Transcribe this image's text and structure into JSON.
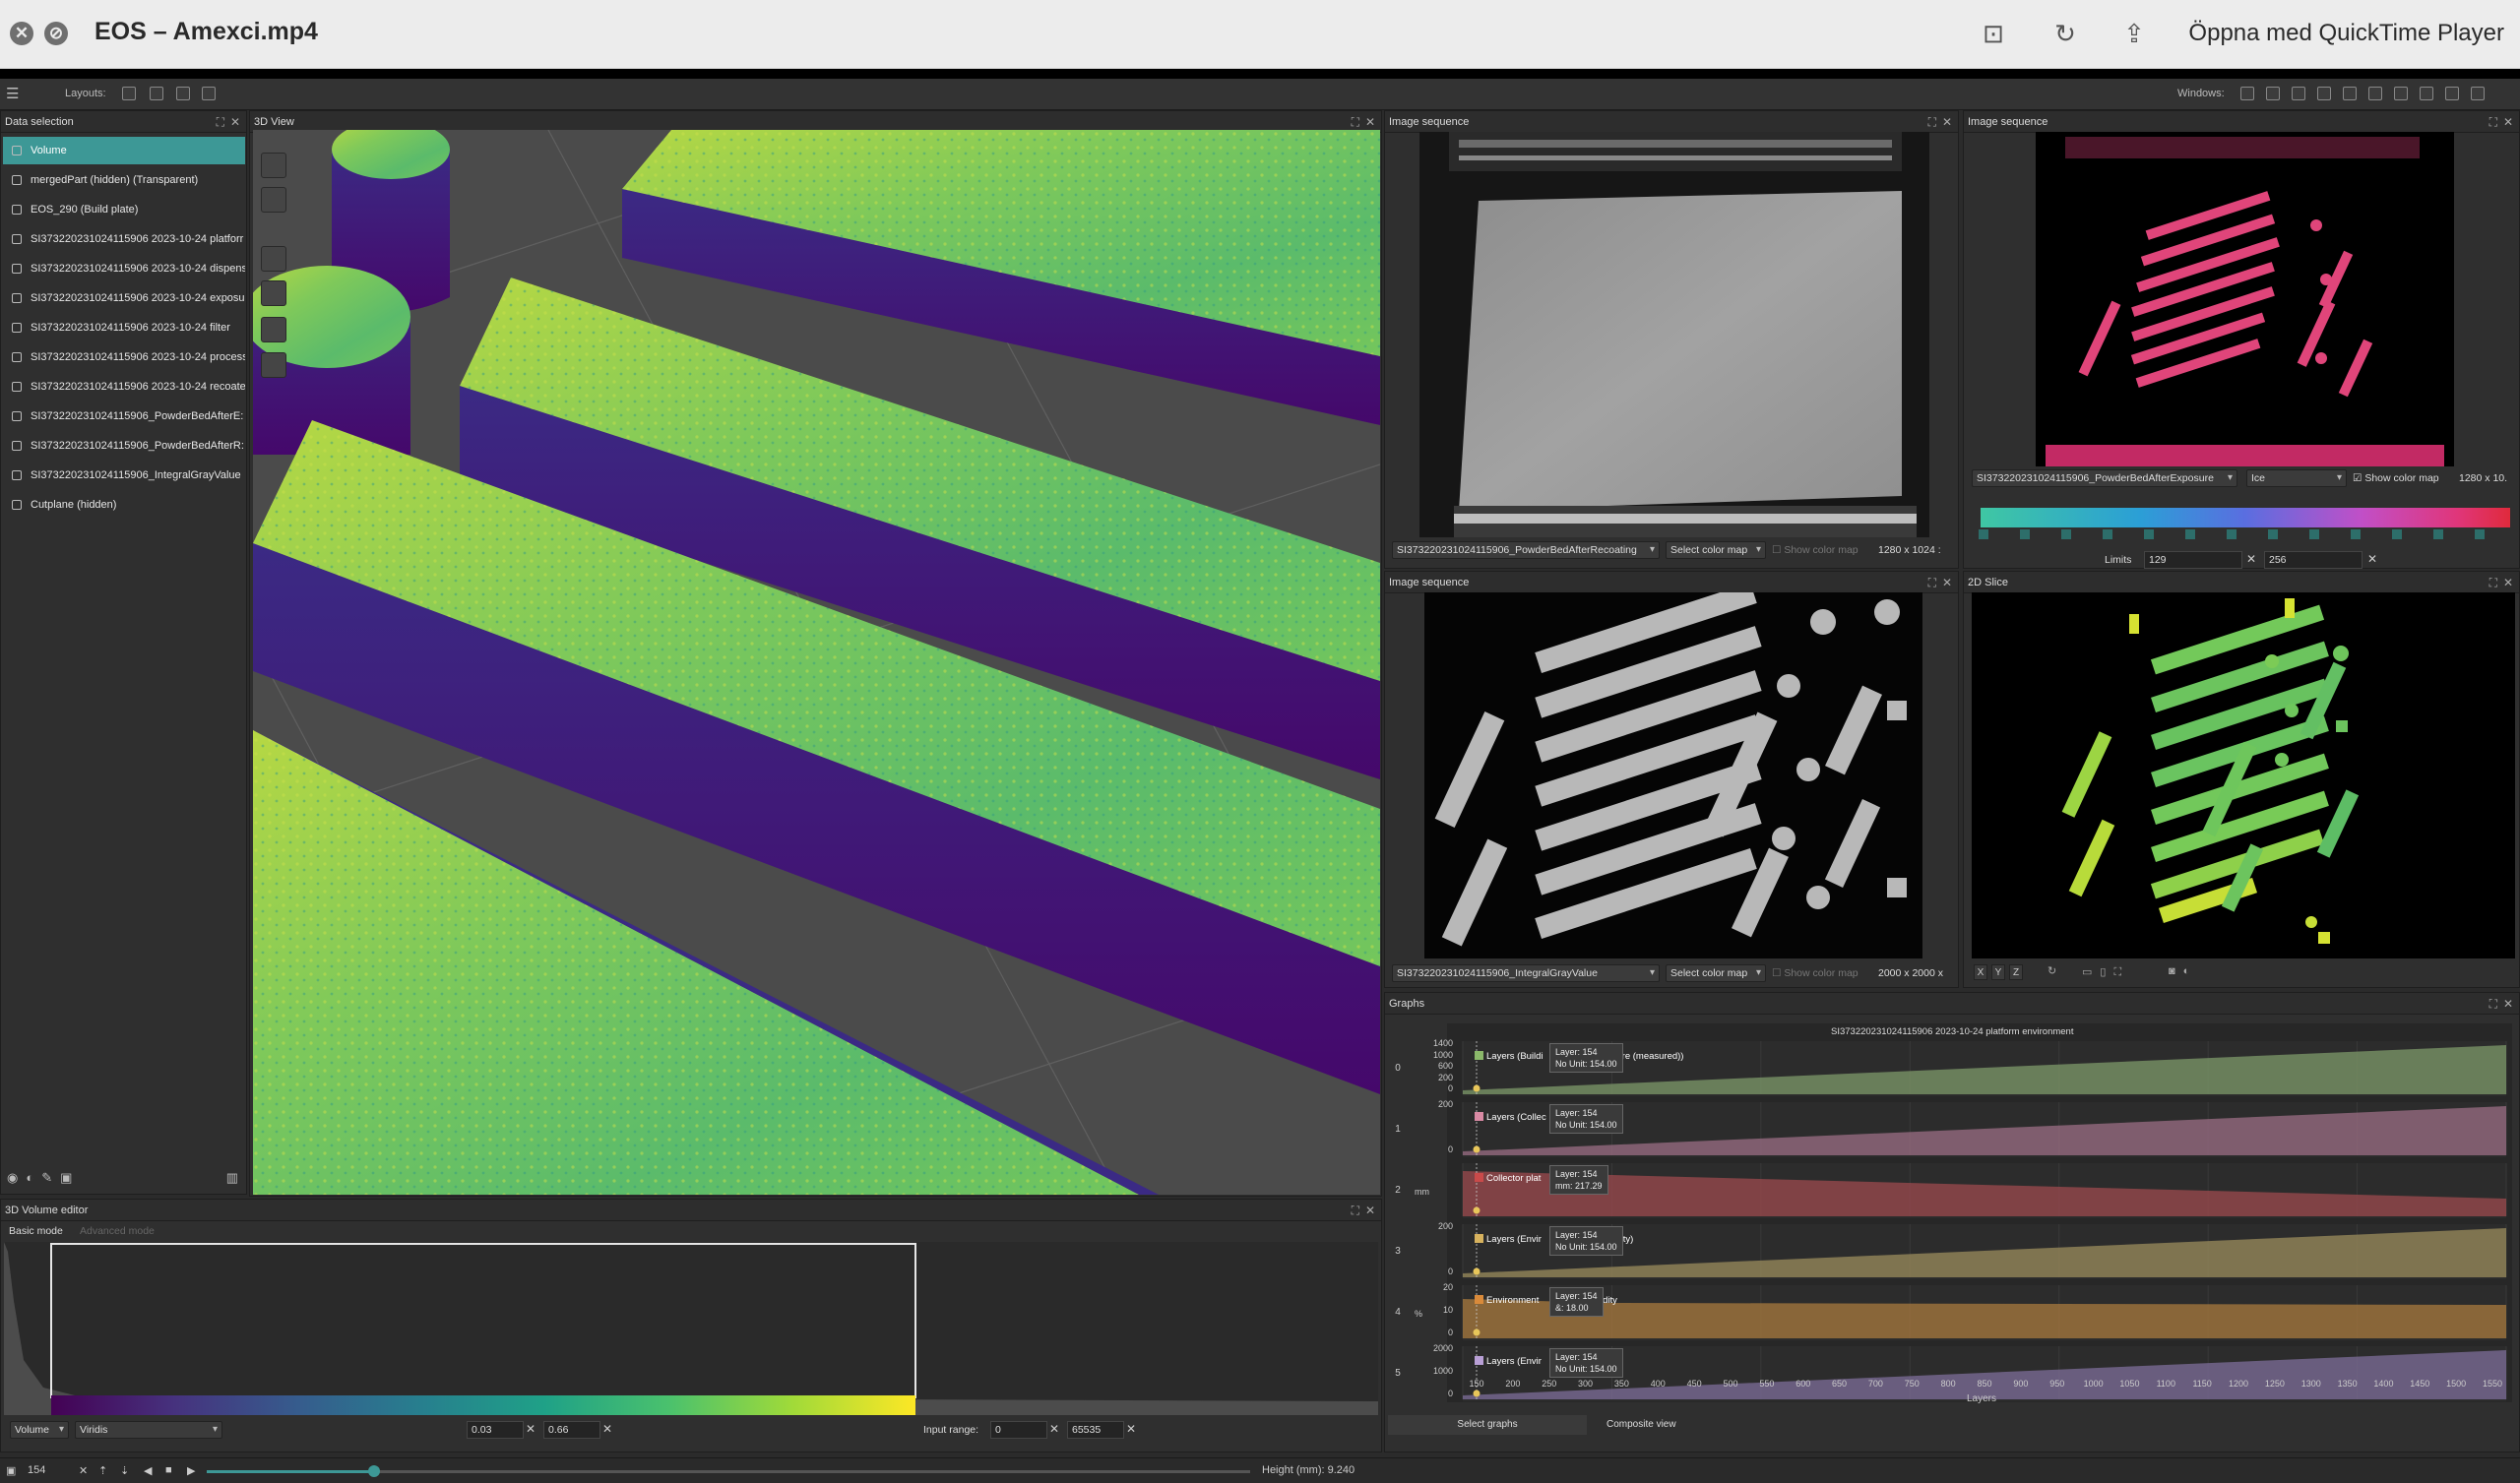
{
  "window": {
    "title": "EOS – Amexci.mp4",
    "open_with_label": "Öppna med QuickTime Player",
    "close_glyph": "✕",
    "stop_glyph": "⊘",
    "trim_glyph": "⊡",
    "rotate_glyph": "↻",
    "share_glyph": "⇪"
  },
  "appbar": {
    "menu_glyph": "☰",
    "layouts_label": "Layouts:",
    "windows_label": "Windows:"
  },
  "data_selection": {
    "title": "Data selection",
    "items": [
      {
        "label": "Volume",
        "selected": true,
        "icon": "target-icon"
      },
      {
        "label": "mergedPart (hidden) (Transparent)",
        "selected": false,
        "icon": "mesh-icon"
      },
      {
        "label": "EOS_290 (Build plate)",
        "selected": false,
        "icon": "mesh-icon"
      },
      {
        "label": "SI373220231024115906 2023-10-24 platforr",
        "selected": false,
        "icon": "graph-icon"
      },
      {
        "label": "SI373220231024115906 2023-10-24 dispens",
        "selected": false,
        "icon": "graph-icon"
      },
      {
        "label": "SI373220231024115906 2023-10-24 exposu",
        "selected": false,
        "icon": "graph-icon"
      },
      {
        "label": "SI373220231024115906 2023-10-24 filter",
        "selected": false,
        "icon": "graph-icon"
      },
      {
        "label": "SI373220231024115906 2023-10-24 process",
        "selected": false,
        "icon": "graph-icon"
      },
      {
        "label": "SI373220231024115906 2023-10-24 recoate",
        "selected": false,
        "icon": "graph-icon"
      },
      {
        "label": "SI373220231024115906_PowderBedAfterE:",
        "selected": false,
        "icon": "image-stack-icon"
      },
      {
        "label": "SI373220231024115906_PowderBedAfterR:",
        "selected": false,
        "icon": "image-stack-icon"
      },
      {
        "label": "SI373220231024115906_IntegralGrayValue",
        "selected": false,
        "icon": "image-stack-icon"
      },
      {
        "label": "Cutplane (hidden)",
        "selected": false,
        "icon": "cutplane-icon"
      }
    ]
  },
  "view3d": {
    "title": "3D View"
  },
  "image_seq_1": {
    "title": "Image sequence",
    "source": "SI373220231024115906_PowderBedAfterRecoating",
    "colormap": "Select color map",
    "show_colormap": "Show color map",
    "size": "1280 x 1024 :"
  },
  "image_seq_2": {
    "title": "Image sequence",
    "source": "SI373220231024115906_PowderBedAfterExposure",
    "colormap": "Ice",
    "show_colormap": "Show color map",
    "size": "1280 x 10.",
    "limits_label": "Limits",
    "limit_min": "129",
    "limit_max": "256"
  },
  "image_seq_3": {
    "title": "Image sequence",
    "source": "SI373220231024115906_IntegralGrayValue",
    "colormap": "Select color map",
    "show_colormap": "Show color map",
    "size": "2000 x 2000 x"
  },
  "slice2d": {
    "title": "2D Slice",
    "axis_buttons": [
      "X",
      "Y",
      "Z"
    ]
  },
  "volume_editor": {
    "title": "3D Volume editor",
    "basic_tab": "Basic mode",
    "advanced_tab": "Advanced mode",
    "type": "Volume",
    "colormap": "Viridis",
    "range_min": "0.03",
    "range_max": "0.66",
    "input_range_label": "Input range:",
    "input_min": "0",
    "input_max": "65535"
  },
  "graphs": {
    "title": "Graphs",
    "chart_title": "SI373220231024115906 2023-10-24 platform environment",
    "row_numbers": [
      "0",
      "1",
      "2",
      "3",
      "4",
      "5"
    ],
    "rows": [
      {
        "legend": "Layers (Buildi",
        "legend_suffix": "erature (measured))",
        "color": "#8bb86a",
        "tip_layer": "Layer:   154",
        "tip_value": "No Unit:  154.00",
        "yticks": [
          "1400",
          "1000",
          "600",
          "200",
          "0"
        ]
      },
      {
        "legend": "Layers (Collec",
        "legend_suffix": "tion)",
        "color": "#d98aa4",
        "tip_layer": "Layer:   154",
        "tip_value": "No Unit:  154.00",
        "yticks": [
          "200",
          "0"
        ]
      },
      {
        "legend": "Collector plat",
        "legend_suffix": "",
        "color": "#c94a4a",
        "tip_layer": "Layer:   154",
        "tip_value": "mm:  217.29",
        "yticks": []
      },
      {
        "legend": "Layers (Envir",
        "legend_suffix": "umidity)",
        "color": "#d7b25e",
        "tip_layer": "Layer:   154",
        "tip_value": "No Unit:  154.00",
        "yticks": [
          "200",
          "0"
        ]
      },
      {
        "legend": "Environment",
        "legend_suffix": "idity",
        "color": "#d98a3a",
        "tip_layer": "Layer:   154",
        "tip_value": "&:  18.00",
        "yticks": [
          "20",
          "10",
          "0"
        ]
      },
      {
        "legend": "Layers (Envir",
        "legend_suffix": "ure)",
        "color": "#b9a0d6",
        "tip_layer": "Layer:   154",
        "tip_value": "No Unit:  154.00",
        "yticks": [
          "2000",
          "1000",
          "0"
        ]
      }
    ],
    "axis_unit_row2": "mm",
    "axis_unit_row4": "%",
    "xlabel": "Layers",
    "xticks": [
      "150",
      "200",
      "250",
      "300",
      "350",
      "400",
      "450",
      "500",
      "550",
      "600",
      "650",
      "700",
      "750",
      "800",
      "850",
      "900",
      "950",
      "1000",
      "1050",
      "1100",
      "1150",
      "1200",
      "1250",
      "1300",
      "1350",
      "1400",
      "1450",
      "1500",
      "1550"
    ],
    "select_graphs_tab": "Select graphs",
    "composite_view_tab": "Composite view"
  },
  "bottom": {
    "layer": "154",
    "height_label": "Height (mm): 9.240",
    "slider_fraction": 0.16
  }
}
